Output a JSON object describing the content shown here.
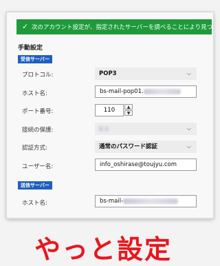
{
  "banner": {
    "icon": "check-icon",
    "text": "次のアカウント設定が、指定されたサーバーを調べることにより見つかりました:"
  },
  "manual_settings_title": "手動設定",
  "incoming": {
    "badge": "受信サーバー",
    "protocol": {
      "label": "プロトコル:",
      "value": "POP3"
    },
    "host": {
      "label": "ホスト名:",
      "value": "bs-mail-pop01."
    },
    "port": {
      "label": "ポート番号:",
      "value": "110"
    },
    "security": {
      "label": "接続の保護:",
      "value": ""
    },
    "auth": {
      "label": "認証方式:",
      "value": "通常のパスワード認証"
    },
    "username": {
      "label": "ユーザー名:",
      "value": "info_oshirase@toujyu.com"
    }
  },
  "outgoing": {
    "badge": "送信サーバー",
    "host": {
      "label": "ホスト名:",
      "value": "bs-mail-"
    }
  },
  "caption": "やっと設定",
  "colors": {
    "banner": "#1e9a3a",
    "badge": "#1f5fc0",
    "caption": "#e8161e"
  }
}
